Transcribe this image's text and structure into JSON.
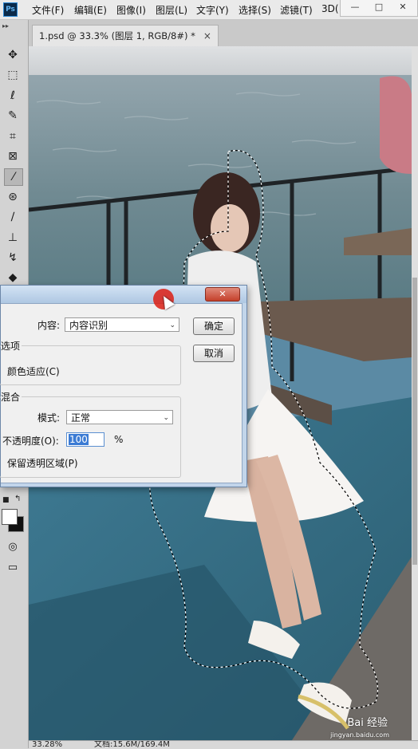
{
  "app": {
    "logo": "Ps"
  },
  "menu": {
    "items": [
      "文件(F)",
      "编辑(E)",
      "图像(I)",
      "图层(L)",
      "文字(Y)",
      "选择(S)",
      "滤镜(T)",
      "3D("
    ]
  },
  "window_controls": {
    "minimize": "—",
    "restore": "□",
    "close": "✕"
  },
  "toolbox": {
    "expand": "▸▸",
    "tools": [
      "move-icon",
      "marquee-icon",
      "lasso-icon",
      "quick-select-icon",
      "crop-icon",
      "frame-icon",
      "eyedropper-icon",
      "healing-icon",
      "brush-icon",
      "stamp-icon",
      "history-brush-icon",
      "eraser-icon"
    ],
    "glyphs": [
      "✥",
      "⬚",
      "ℓ",
      "✎",
      "⌗",
      "⊠",
      "⁄",
      "⊛",
      "∕",
      "⊥",
      "↯",
      "◆"
    ],
    "swap": "↰",
    "quickmask": "◎",
    "screenmode": "▭"
  },
  "document_tab": {
    "title": "1.psd @ 33.3% (图层 1, RGB/8#) *",
    "close": "×"
  },
  "dialog": {
    "close": "✕",
    "content_label": "内容:",
    "content_value": "内容识别",
    "ok": "确定",
    "cancel": "取消",
    "options_title": "选项",
    "color_adapt": "颜色适应(C)",
    "blend_title": "混合",
    "mode_label": "模式:",
    "mode_value": "正常",
    "opacity_label": "不透明度(O):",
    "opacity_value": "100",
    "opacity_unit": "%",
    "preserve": "保留透明区域(P)"
  },
  "status": {
    "zoom": "33.28%",
    "doc": "文档:15.6M/169.4M"
  },
  "watermark": {
    "brand": "Bai 经验",
    "url": "jingyan.baidu.com"
  },
  "colors": {
    "menu_bg": "#eaeaea",
    "toolbox_bg": "#d3d3d3",
    "dialog_title": "#c2d5ea",
    "close_red": "#c4402b"
  }
}
